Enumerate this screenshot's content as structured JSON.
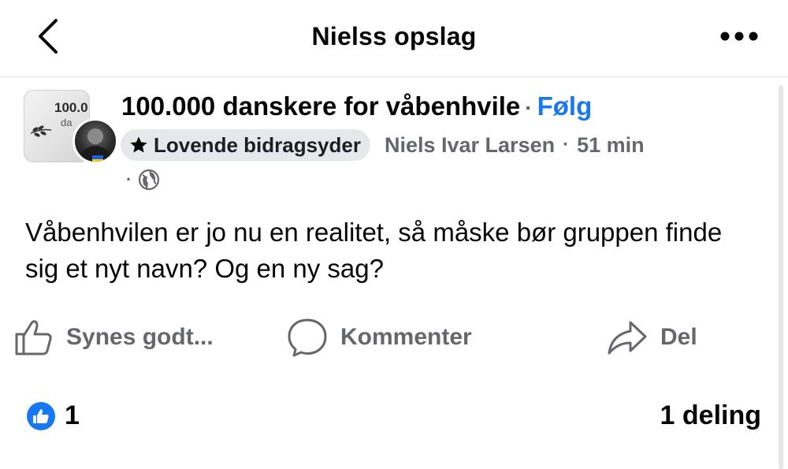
{
  "header": {
    "title": "Nielss opslag",
    "back_icon": "chevron-left-icon",
    "more_icon": "more-horizontal-icon"
  },
  "post": {
    "group_name": "100.000 danskere for våbenhvile",
    "follow_label": "Følg",
    "group_avatar_text": "100.0",
    "group_avatar_sub": "da",
    "badge_label": "Lovende bidragsyder",
    "badge_icon": "star-icon",
    "author": "Niels Ivar Larsen",
    "time": "51 min",
    "privacy_icon": "globe-icon",
    "text": "Våbenhvilen er jo nu en realitet, så måske bør gruppen finde sig et nyt navn? Og en ny sag?"
  },
  "actions": {
    "like_label": "Synes godt...",
    "comment_label": "Kommenter",
    "share_label": "Del"
  },
  "stats": {
    "like_count": "1",
    "shares": "1 deling"
  },
  "colors": {
    "accent": "#1877f2",
    "secondary_text": "#65676b",
    "badge_bg": "#e6e8eb"
  }
}
